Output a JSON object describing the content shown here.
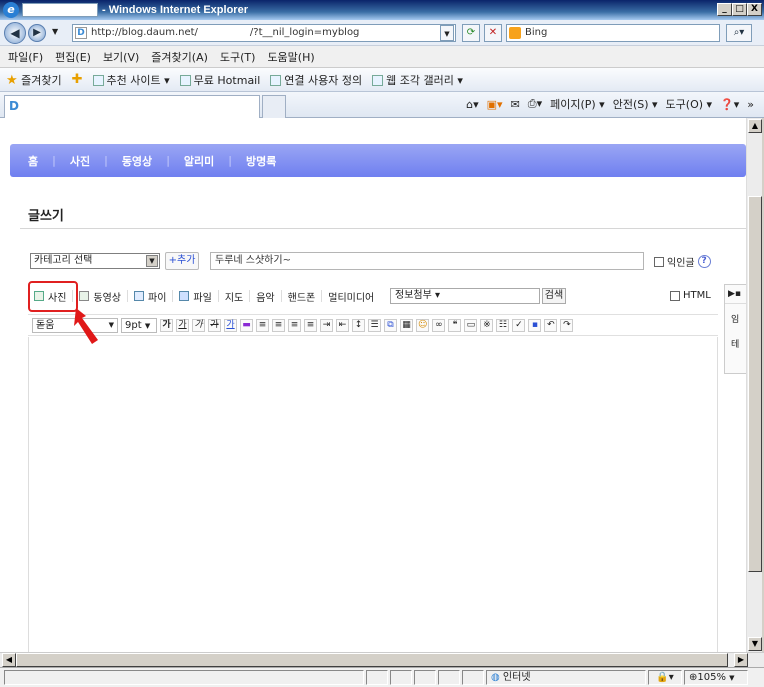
{
  "window": {
    "title": "- Windows Internet Explorer",
    "min": "_",
    "max": "□",
    "close": "X"
  },
  "address": {
    "url": "http://blog.daum.net/",
    "url_suffix": "/?t__nil_login=myblog",
    "search_placeholder": "Bing"
  },
  "menu": [
    "파일(F)",
    "편집(E)",
    "보기(V)",
    "즐겨찾기(A)",
    "도구(T)",
    "도움말(H)"
  ],
  "favorites": {
    "label": "즐겨찾기",
    "items": [
      "추천 사이트 ▾",
      "무료 Hotmail",
      "연결 사용자 정의",
      "웹 조각 갤러리 ▾"
    ]
  },
  "commandbar": [
    "페이지(P) ▾",
    "안전(S) ▾",
    "도구(O) ▾"
  ],
  "blog": {
    "nav": [
      "홈",
      "사진",
      "동영상",
      "알리미",
      "방명록"
    ],
    "page_title": "글쓰기",
    "category_placeholder": "카테고리 선택",
    "add_category": "+추가",
    "post_title": "두루네 스샷하기~",
    "anonymous_label": "익인글",
    "attach": [
      "사진",
      "동영상",
      "파이",
      "파일",
      "지도",
      "음악",
      "핸드폰",
      "멀티미디어"
    ],
    "info_select": "정보첨부 ▾",
    "search_btn": "검색",
    "html_label": "HTML",
    "font": "돋움",
    "size": "9pt",
    "format_buttons": [
      "가",
      "가",
      "가",
      "가",
      "가"
    ],
    "side_labels": [
      "임",
      "테"
    ]
  },
  "status": {
    "zone": "인터넷",
    "zoom": "105%"
  }
}
